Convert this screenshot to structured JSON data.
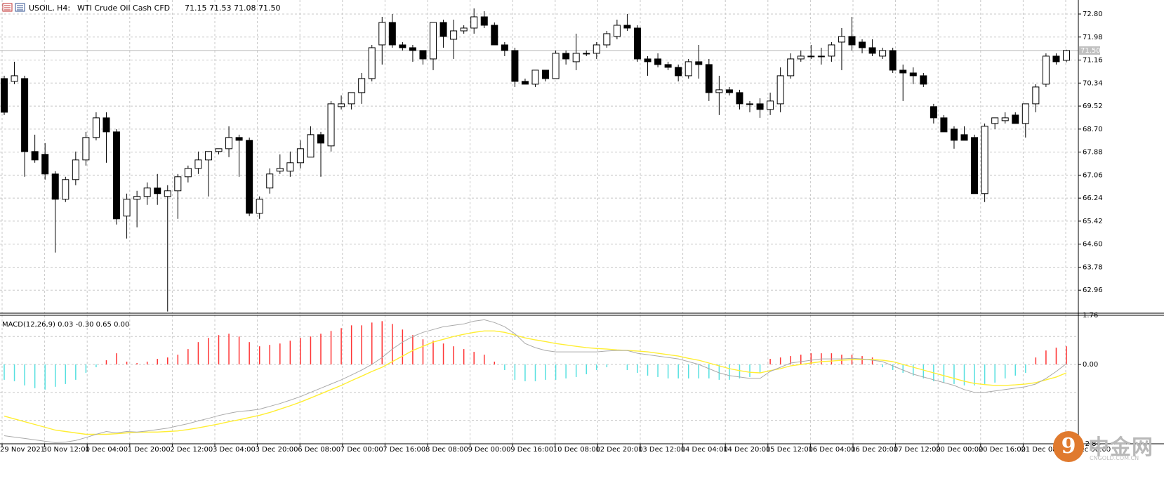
{
  "header": {
    "symbol_title": "USOIL, H4:",
    "description": "WTI Crude Oil Cash CFD",
    "ohlc": "71.15 71.53 71.08 71.50"
  },
  "macd_header": {
    "label": "MACD(12,26,9) 0.03 -0.30 0.65 0.00"
  },
  "colors": {
    "bull_body": "#ffffff",
    "bear_body": "#000000",
    "macd_positive": "#ff3333",
    "macd_negative": "#55e0e0",
    "signal_line": "#ffee33",
    "macd_line": "#aaaaaa",
    "grid": "#c8c8c8"
  },
  "watermark": {
    "brand_cn": "中金网",
    "url": "CNGOLD.COM.CN"
  },
  "chart_data": [
    {
      "type": "candlestick",
      "symbol": "USOIL",
      "timeframe": "H4",
      "current_price": "71.50",
      "ylim": [
        62.14,
        73.3
      ],
      "y_ticks": [
        "72.80",
        "71.98",
        "71.16",
        "70.34",
        "69.52",
        "68.70",
        "67.88",
        "67.06",
        "66.24",
        "65.42",
        "64.60",
        "63.78",
        "62.96"
      ],
      "x_ticks": [
        "29 Nov 2021",
        "30 Nov 12:00",
        "1 Dec 04:00",
        "1 Dec 20:00",
        "2 Dec 12:00",
        "3 Dec 04:00",
        "3 Dec 20:00",
        "6 Dec 08:00",
        "7 Dec 00:00",
        "7 Dec 16:00",
        "8 Dec 08:00",
        "9 Dec 00:00",
        "9 Dec 16:00",
        "10 Dec 08:00",
        "12 Dec 20:00",
        "13 Dec 12:00",
        "14 Dec 04:00",
        "14 Dec 20:00",
        "15 Dec 12:00",
        "16 Dec 04:00",
        "16 Dec 20:00",
        "17 Dec 12:00",
        "20 Dec 00:00",
        "20 Dec 16:00",
        "21 Dec 08:00",
        "22 Dec 00:00"
      ],
      "candles": [
        [
          70.5,
          70.6,
          69.2,
          69.3
        ],
        [
          70.4,
          71.1,
          70.3,
          70.6
        ],
        [
          70.5,
          70.6,
          67.0,
          67.9
        ],
        [
          67.9,
          68.5,
          67.5,
          67.6
        ],
        [
          67.8,
          68.2,
          66.9,
          67.1
        ],
        [
          67.1,
          67.2,
          64.3,
          66.2
        ],
        [
          66.2,
          67.0,
          66.1,
          66.9
        ],
        [
          66.9,
          67.9,
          66.7,
          67.6
        ],
        [
          67.6,
          68.6,
          67.4,
          68.4
        ],
        [
          68.4,
          69.3,
          68.3,
          69.1
        ],
        [
          69.1,
          69.3,
          67.5,
          68.6
        ],
        [
          68.6,
          68.7,
          65.3,
          65.5
        ],
        [
          65.6,
          66.4,
          64.8,
          66.2
        ],
        [
          66.2,
          66.5,
          65.2,
          66.3
        ],
        [
          66.3,
          66.8,
          66.0,
          66.6
        ],
        [
          66.6,
          67.1,
          66.0,
          66.4
        ],
        [
          66.3,
          66.7,
          62.2,
          66.5
        ],
        [
          66.5,
          67.1,
          65.5,
          67.0
        ],
        [
          67.0,
          67.4,
          66.8,
          67.3
        ],
        [
          67.3,
          67.9,
          67.1,
          67.6
        ],
        [
          67.6,
          67.9,
          66.3,
          67.9
        ],
        [
          67.9,
          68.0,
          67.8,
          68.0
        ],
        [
          68.0,
          68.8,
          67.7,
          68.4
        ],
        [
          68.4,
          68.5,
          67.0,
          68.3
        ],
        [
          68.3,
          68.4,
          65.6,
          65.7
        ],
        [
          65.7,
          66.3,
          65.5,
          66.2
        ],
        [
          66.6,
          67.3,
          66.4,
          67.1
        ],
        [
          67.2,
          67.8,
          67.1,
          67.3
        ],
        [
          67.2,
          67.9,
          67.0,
          67.5
        ],
        [
          67.5,
          68.3,
          67.3,
          68.0
        ],
        [
          67.7,
          68.8,
          67.7,
          68.5
        ],
        [
          68.5,
          68.6,
          67.0,
          68.2
        ],
        [
          68.1,
          69.7,
          67.9,
          69.6
        ],
        [
          69.5,
          69.9,
          69.4,
          69.6
        ],
        [
          69.6,
          70.0,
          69.4,
          70.0
        ],
        [
          70.0,
          70.7,
          69.6,
          70.5
        ],
        [
          70.5,
          71.7,
          70.4,
          71.6
        ],
        [
          71.7,
          72.7,
          71.0,
          72.5
        ],
        [
          72.5,
          72.8,
          71.6,
          71.7
        ],
        [
          71.7,
          71.8,
          71.5,
          71.6
        ],
        [
          71.6,
          71.7,
          71.1,
          71.5
        ],
        [
          71.5,
          71.5,
          71.0,
          71.2
        ],
        [
          71.2,
          72.5,
          70.8,
          72.5
        ],
        [
          72.5,
          72.6,
          71.6,
          72.0
        ],
        [
          71.9,
          72.6,
          71.2,
          72.2
        ],
        [
          72.2,
          72.4,
          72.1,
          72.3
        ],
        [
          72.3,
          73.0,
          72.1,
          72.7
        ],
        [
          72.7,
          72.9,
          72.3,
          72.4
        ],
        [
          72.4,
          72.5,
          71.7,
          71.7
        ],
        [
          71.7,
          71.8,
          71.3,
          71.5
        ],
        [
          71.5,
          71.6,
          70.2,
          70.4
        ],
        [
          70.4,
          70.5,
          70.3,
          70.3
        ],
        [
          70.3,
          70.8,
          70.2,
          70.8
        ],
        [
          70.8,
          70.8,
          70.4,
          70.5
        ],
        [
          70.5,
          71.5,
          70.5,
          71.4
        ],
        [
          71.4,
          71.5,
          71.0,
          71.2
        ],
        [
          71.1,
          72.1,
          70.8,
          71.4
        ],
        [
          71.4,
          71.5,
          71.3,
          71.4
        ],
        [
          71.4,
          71.8,
          71.2,
          71.7
        ],
        [
          71.7,
          72.2,
          71.6,
          72.1
        ],
        [
          72.0,
          72.6,
          71.9,
          72.4
        ],
        [
          72.4,
          72.8,
          72.2,
          72.3
        ],
        [
          72.3,
          72.4,
          71.1,
          71.2
        ],
        [
          71.2,
          71.3,
          70.6,
          71.1
        ],
        [
          71.2,
          71.4,
          70.9,
          71.0
        ],
        [
          71.0,
          71.1,
          70.8,
          70.9
        ],
        [
          70.9,
          71.0,
          70.4,
          70.6
        ],
        [
          70.6,
          71.2,
          70.5,
          71.1
        ],
        [
          71.1,
          71.7,
          70.5,
          71.0
        ],
        [
          71.0,
          71.2,
          69.7,
          70.0
        ],
        [
          70.0,
          70.6,
          69.2,
          70.1
        ],
        [
          70.1,
          70.2,
          69.9,
          70.0
        ],
        [
          70.0,
          70.1,
          69.4,
          69.6
        ],
        [
          69.6,
          69.7,
          69.3,
          69.6
        ],
        [
          69.6,
          69.8,
          69.1,
          69.4
        ],
        [
          69.4,
          70.0,
          69.2,
          69.7
        ],
        [
          69.6,
          70.9,
          69.3,
          70.6
        ],
        [
          70.6,
          71.4,
          70.5,
          71.2
        ],
        [
          71.2,
          71.5,
          71.1,
          71.3
        ],
        [
          71.3,
          71.7,
          71.2,
          71.3
        ],
        [
          71.3,
          71.6,
          71.0,
          71.3
        ],
        [
          71.3,
          71.8,
          71.1,
          71.7
        ],
        [
          71.8,
          72.3,
          70.8,
          72.0
        ],
        [
          72.0,
          72.7,
          71.5,
          71.7
        ],
        [
          71.8,
          71.9,
          71.4,
          71.6
        ],
        [
          71.6,
          71.9,
          71.3,
          71.4
        ],
        [
          71.3,
          71.6,
          71.2,
          71.5
        ],
        [
          71.5,
          71.6,
          70.7,
          70.8
        ],
        [
          70.8,
          71.0,
          69.7,
          70.7
        ],
        [
          70.7,
          70.9,
          70.3,
          70.6
        ],
        [
          70.6,
          70.7,
          70.2,
          70.3
        ],
        [
          69.5,
          69.6,
          68.9,
          69.1
        ],
        [
          69.1,
          69.2,
          68.6,
          68.6
        ],
        [
          68.7,
          68.8,
          68.0,
          68.3
        ],
        [
          68.5,
          68.8,
          68.4,
          68.3
        ],
        [
          68.4,
          68.5,
          66.4,
          66.4
        ],
        [
          66.4,
          68.9,
          66.1,
          68.8
        ],
        [
          68.9,
          69.1,
          68.7,
          69.1
        ],
        [
          69.0,
          69.3,
          68.9,
          69.1
        ],
        [
          69.2,
          69.3,
          68.9,
          68.9
        ],
        [
          68.9,
          69.6,
          68.4,
          69.6
        ],
        [
          69.6,
          70.3,
          69.3,
          70.2
        ],
        [
          70.3,
          71.4,
          70.2,
          71.3
        ],
        [
          71.3,
          71.4,
          71.0,
          71.1
        ],
        [
          71.15,
          71.53,
          71.08,
          71.5
        ]
      ]
    },
    {
      "type": "macd",
      "params": "12,26,9",
      "ylim": [
        -2.84,
        1.76
      ],
      "y_ticks": [
        "1.76",
        "0.00",
        "-2.84"
      ],
      "histogram": [
        -0.55,
        -0.6,
        -0.75,
        -0.85,
        -0.9,
        -0.8,
        -0.7,
        -0.55,
        -0.3,
        -0.1,
        0.15,
        0.4,
        0.1,
        0.05,
        0.1,
        0.2,
        0.25,
        0.35,
        0.55,
        0.8,
        0.95,
        1.05,
        1.1,
        1.0,
        0.8,
        0.65,
        0.7,
        0.75,
        0.85,
        0.95,
        1.0,
        1.1,
        1.2,
        1.3,
        1.4,
        1.4,
        1.5,
        1.55,
        1.45,
        1.25,
        1.05,
        0.9,
        0.85,
        0.75,
        0.65,
        0.55,
        0.45,
        0.35,
        0.1,
        -0.2,
        -0.55,
        -0.6,
        -0.6,
        -0.55,
        -0.55,
        -0.5,
        -0.45,
        -0.35,
        -0.2,
        -0.1,
        0.0,
        -0.2,
        -0.3,
        -0.4,
        -0.45,
        -0.5,
        -0.5,
        -0.5,
        -0.5,
        -0.5,
        -0.55,
        -0.55,
        -0.5,
        -0.45,
        -0.3,
        0.2,
        0.25,
        0.3,
        0.35,
        0.4,
        0.4,
        0.4,
        0.35,
        0.35,
        0.3,
        0.25,
        -0.1,
        -0.2,
        -0.3,
        -0.4,
        -0.5,
        -0.6,
        -0.65,
        -0.7,
        -0.75,
        -0.75,
        -0.7,
        -0.65,
        -0.5,
        -0.4,
        -0.3,
        0.25,
        0.5,
        0.6,
        0.65
      ],
      "macd_line": [
        -2.55,
        -2.6,
        -2.65,
        -2.7,
        -2.75,
        -2.8,
        -2.78,
        -2.72,
        -2.62,
        -2.5,
        -2.4,
        -2.45,
        -2.4,
        -2.42,
        -2.38,
        -2.33,
        -2.28,
        -2.2,
        -2.12,
        -2.02,
        -1.93,
        -1.83,
        -1.75,
        -1.68,
        -1.65,
        -1.6,
        -1.5,
        -1.4,
        -1.28,
        -1.15,
        -1.0,
        -0.85,
        -0.7,
        -0.55,
        -0.38,
        -0.2,
        0.0,
        0.25,
        0.55,
        0.8,
        1.0,
        1.15,
        1.25,
        1.35,
        1.4,
        1.45,
        1.55,
        1.6,
        1.5,
        1.35,
        1.1,
        0.75,
        0.6,
        0.5,
        0.45,
        0.45,
        0.45,
        0.45,
        0.45,
        0.48,
        0.5,
        0.5,
        0.4,
        0.35,
        0.3,
        0.25,
        0.2,
        0.1,
        0.0,
        -0.15,
        -0.3,
        -0.4,
        -0.45,
        -0.5,
        -0.5,
        -0.25,
        -0.1,
        0.05,
        0.1,
        0.15,
        0.2,
        0.2,
        0.2,
        0.22,
        0.2,
        0.15,
        0.1,
        -0.05,
        -0.2,
        -0.35,
        -0.45,
        -0.55,
        -0.65,
        -0.75,
        -0.9,
        -1.0,
        -1.0,
        -0.95,
        -0.9,
        -0.85,
        -0.8,
        -0.7,
        -0.5,
        -0.25,
        0.03
      ],
      "signal_line": [
        -1.85,
        -1.95,
        -2.05,
        -2.15,
        -2.25,
        -2.35,
        -2.4,
        -2.45,
        -2.5,
        -2.5,
        -2.5,
        -2.48,
        -2.45,
        -2.43,
        -2.42,
        -2.42,
        -2.4,
        -2.38,
        -2.33,
        -2.27,
        -2.2,
        -2.13,
        -2.05,
        -1.98,
        -1.9,
        -1.82,
        -1.72,
        -1.6,
        -1.48,
        -1.35,
        -1.2,
        -1.05,
        -0.9,
        -0.75,
        -0.58,
        -0.42,
        -0.25,
        -0.1,
        0.1,
        0.3,
        0.5,
        0.65,
        0.8,
        0.9,
        1.0,
        1.08,
        1.15,
        1.2,
        1.2,
        1.15,
        1.05,
        0.95,
        0.88,
        0.82,
        0.75,
        0.7,
        0.65,
        0.6,
        0.57,
        0.55,
        0.52,
        0.5,
        0.48,
        0.45,
        0.4,
        0.35,
        0.3,
        0.22,
        0.15,
        0.05,
        -0.05,
        -0.15,
        -0.22,
        -0.28,
        -0.3,
        -0.22,
        -0.15,
        -0.05,
        0.0,
        0.05,
        0.1,
        0.12,
        0.15,
        0.17,
        0.18,
        0.18,
        0.15,
        0.1,
        0.0,
        -0.1,
        -0.2,
        -0.3,
        -0.4,
        -0.5,
        -0.6,
        -0.68,
        -0.72,
        -0.75,
        -0.75,
        -0.73,
        -0.7,
        -0.65,
        -0.55,
        -0.45,
        -0.3
      ]
    }
  ]
}
